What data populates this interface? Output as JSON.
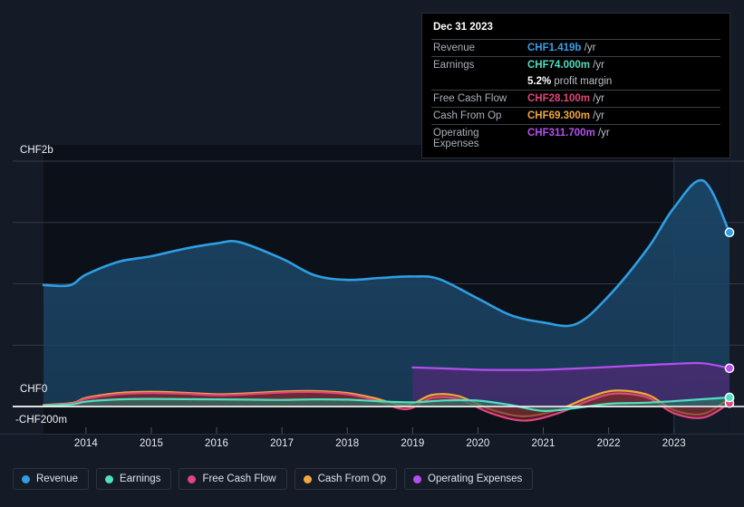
{
  "axis": {
    "y_labels": [
      {
        "text": "CHF2b",
        "value": 2000,
        "y": 166
      },
      {
        "text": "CHF0",
        "value": 0,
        "y": 429
      },
      {
        "text": "-CHF200m",
        "value": -200,
        "y": 459
      }
    ],
    "x_labels": [
      "2014",
      "2015",
      "2016",
      "2017",
      "2018",
      "2019",
      "2020",
      "2021",
      "2022",
      "2023"
    ],
    "currency": "CHF"
  },
  "tooltip": {
    "date": "Dec 31 2023",
    "rows": [
      {
        "label": "Revenue",
        "value": "CHF1.419b",
        "unit": "/yr",
        "color": "#3aa0e8"
      },
      {
        "label": "Earnings",
        "value": "CHF74.000m",
        "unit": "/yr",
        "color": "#4fdfc2"
      },
      {
        "label": "",
        "value": "5.2%",
        "unit": "profit margin",
        "color": "#ffffff"
      },
      {
        "label": "Free Cash Flow",
        "value": "CHF28.100m",
        "unit": "/yr",
        "color": "#e0457b"
      },
      {
        "label": "Cash From Op",
        "value": "CHF69.300m",
        "unit": "/yr",
        "color": "#f2a83e"
      },
      {
        "label": "Operating Expenses",
        "value": "CHF311.700m",
        "unit": "/yr",
        "color": "#b54ff0"
      }
    ]
  },
  "legend": [
    {
      "label": "Revenue",
      "color": "#2f9ee3"
    },
    {
      "label": "Earnings",
      "color": "#4fdfc2"
    },
    {
      "label": "Free Cash Flow",
      "color": "#e0457b"
    },
    {
      "label": "Cash From Op",
      "color": "#f2a83e"
    },
    {
      "label": "Operating Expenses",
      "color": "#b54ff0"
    }
  ],
  "chart_data": {
    "type": "area",
    "title": "",
    "xlabel": "",
    "ylabel": "CHF",
    "units": "CHF millions per year",
    "grid": true,
    "legend_position": "bottom",
    "ylim": [
      -200,
      2000
    ],
    "y_ticks": [
      -200,
      0,
      500,
      1000,
      1500,
      2000
    ],
    "x": [
      "2013.35",
      "2014",
      "2015",
      "2016",
      "2017",
      "2018",
      "2019",
      "2020",
      "2021",
      "2022",
      "2023",
      "2023.85"
    ],
    "xlim": [
      "2013.35",
      "2023.85"
    ],
    "forecast_divider_x": "2023.0",
    "series": [
      {
        "name": "Revenue",
        "color": "#2f9ee3",
        "fill": "#1b4566",
        "x": [
          2013.35,
          2013.75,
          2014.0,
          2014.5,
          2015.0,
          2015.5,
          2016.0,
          2016.35,
          2017.0,
          2017.5,
          2018.0,
          2018.5,
          2019.0,
          2019.4,
          2020.0,
          2020.5,
          2021.0,
          2021.5,
          2022.0,
          2022.6,
          2023.0,
          2023.45,
          2023.85
        ],
        "values": [
          990,
          988,
          1075,
          1180,
          1225,
          1285,
          1330,
          1340,
          1205,
          1070,
          1032,
          1048,
          1060,
          1040,
          880,
          745,
          685,
          672,
          900,
          1290,
          1620,
          1840,
          1419
        ]
      },
      {
        "name": "Operating Expenses",
        "color": "#b54ff0",
        "fill": "#4b2a72",
        "x": [
          2019.0,
          2019.5,
          2020.0,
          2020.5,
          2021.0,
          2021.5,
          2022.0,
          2022.5,
          2023.0,
          2023.45,
          2023.85
        ],
        "values": [
          318,
          310,
          300,
          298,
          300,
          310,
          322,
          336,
          348,
          352,
          311.7
        ]
      },
      {
        "name": "Cash From Op",
        "color": "#f2a83e",
        "fill": "#6b4a1e",
        "x": [
          2013.35,
          2013.8,
          2014.0,
          2014.5,
          2015.0,
          2015.5,
          2016.0,
          2016.5,
          2017.0,
          2017.5,
          2018.0,
          2018.4,
          2018.9,
          2019.3,
          2019.7,
          2020.2,
          2020.7,
          2021.2,
          2021.7,
          2022.1,
          2022.6,
          2023.0,
          2023.45,
          2023.85
        ],
        "values": [
          12,
          30,
          70,
          110,
          120,
          112,
          100,
          108,
          122,
          126,
          110,
          70,
          10,
          95,
          85,
          -25,
          -80,
          -30,
          75,
          130,
          95,
          -30,
          -60,
          69.3
        ]
      },
      {
        "name": "Free Cash Flow",
        "color": "#e0457b",
        "fill": "#6e2336",
        "x": [
          2013.35,
          2013.8,
          2014.0,
          2014.5,
          2015.0,
          2015.5,
          2016.0,
          2016.5,
          2017.0,
          2017.5,
          2018.0,
          2018.4,
          2018.9,
          2019.3,
          2019.7,
          2020.2,
          2020.7,
          2021.2,
          2021.7,
          2022.1,
          2022.6,
          2023.0,
          2023.45,
          2023.85
        ],
        "values": [
          8,
          24,
          62,
          100,
          110,
          104,
          92,
          100,
          114,
          118,
          100,
          55,
          -22,
          70,
          60,
          -55,
          -115,
          -60,
          48,
          105,
          72,
          -55,
          -90,
          28.1
        ]
      },
      {
        "name": "Earnings",
        "color": "#4fdfc2",
        "fill": "#2f6f64",
        "x": [
          2013.35,
          2013.8,
          2014.0,
          2014.5,
          2015.0,
          2015.5,
          2016.0,
          2016.5,
          2017.0,
          2017.5,
          2018.0,
          2018.5,
          2019.0,
          2019.5,
          2020.0,
          2020.5,
          2021.0,
          2021.5,
          2022.0,
          2022.5,
          2023.0,
          2023.45,
          2023.85
        ],
        "values": [
          6,
          18,
          40,
          58,
          62,
          60,
          58,
          56,
          54,
          58,
          56,
          42,
          34,
          50,
          48,
          12,
          -36,
          -12,
          22,
          30,
          44,
          60,
          74
        ]
      }
    ],
    "end_markers": [
      {
        "series": "Revenue",
        "value": 1419,
        "color": "#2f9ee3"
      },
      {
        "series": "Operating Expenses",
        "value": 311.7,
        "color": "#b54ff0"
      },
      {
        "series": "Cash From Op",
        "value": 69.3,
        "color": "#f2a83e"
      },
      {
        "series": "Free Cash Flow",
        "value": 28.1,
        "color": "#e0457b"
      },
      {
        "series": "Earnings",
        "value": 74.0,
        "color": "#4fdfc2"
      }
    ]
  }
}
